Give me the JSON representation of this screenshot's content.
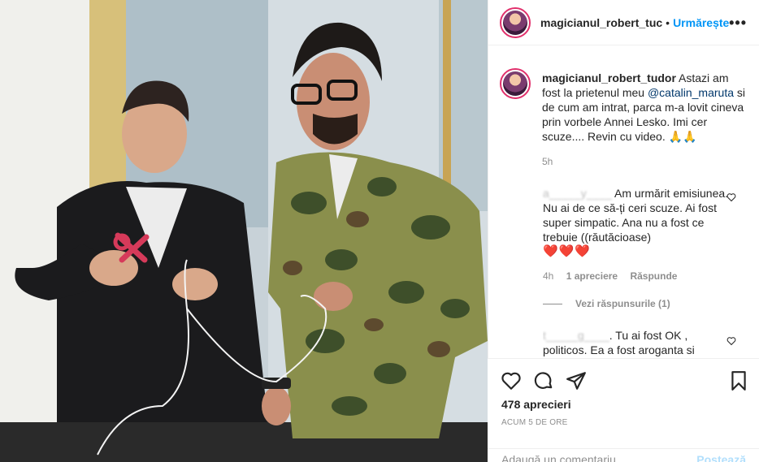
{
  "post": {
    "username": "magicianul_robert_tudor",
    "username_header": "magicianul_robert_tuc",
    "follow_label": "Urmărește",
    "more_label": "•••",
    "caption_pre": "Astazi am fost la prietenul meu",
    "caption_mention": "@catalin_maruta",
    "caption_post": "si de cum am intrat, parca m-a lovit cineva prin vorbele Annei Lesko. Imi cer scuze.... Revin cu video. 🙏🙏",
    "timestamp": "5h"
  },
  "comments": [
    {
      "author_blurred": "a_____y____",
      "text": "Am urmărit emisiunea. Nu ai de ce să-ți ceri scuze. Ai fost super simpatic. Ana nu a fost ce trebuie ((răutăcioase)",
      "hearts": "❤️❤️❤️",
      "time": "4h",
      "likes": "1 apreciere",
      "reply": "Răspunde",
      "view_replies": "Vezi răspunsurile (1)"
    },
    {
      "author_blurred": "t_____g____",
      "text": ". Tu ai fost OK , politicos. Ea a fost aroganta si"
    }
  ],
  "actions": {
    "likes_count": "478 aprecieri",
    "time_ago": "ACUM 5 DE ORE",
    "add_comment_placeholder": "Adaugă un comentariu...",
    "post_label": "Postează"
  },
  "icons": [
    "heart-icon",
    "comment-icon",
    "share-icon",
    "bookmark-icon",
    "more-icon"
  ],
  "colors": {
    "accent": "#0095f6",
    "heart": "#e0245e",
    "muted": "#8e8e8e"
  }
}
